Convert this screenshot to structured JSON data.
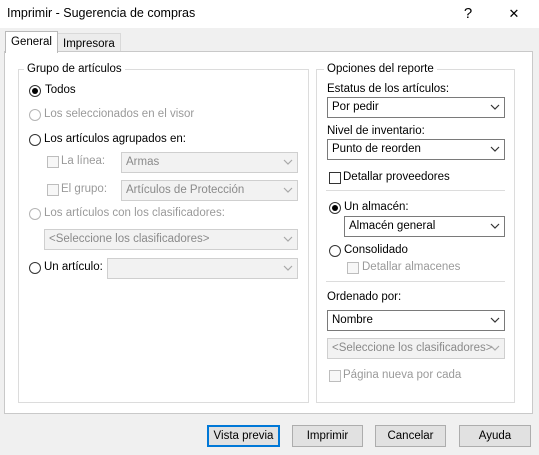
{
  "window": {
    "title": "Imprimir - Sugerencia de compras",
    "help_glyph": "?",
    "close_glyph": "✕"
  },
  "tabs": [
    {
      "label": "General"
    },
    {
      "label": "Impresora"
    }
  ],
  "grupo": {
    "legend": "Grupo de artículos",
    "todos": "Todos",
    "seleccionados": "Los seleccionados en el visor",
    "agrupados": "Los artículos agrupados en:",
    "linea_label": "La línea:",
    "linea_value": "Armas",
    "grupo_label": "El grupo:",
    "grupo_value": "Artículos de Protección",
    "clasificadores": "Los artículos con los clasificadores:",
    "clasificadores_value": "<Seleccione los clasificadores>",
    "un_articulo": "Un artículo:",
    "un_articulo_value": ""
  },
  "opciones": {
    "legend": "Opciones del reporte",
    "estatus_label": "Estatus de los artículos:",
    "estatus_value": "Por pedir",
    "nivel_label": "Nivel de inventario:",
    "nivel_value": "Punto de reorden",
    "detallar_proveedores": "Detallar proveedores",
    "un_almacen": "Un almacén:",
    "almacen_value": "Almacén general",
    "consolidado": "Consolidado",
    "detallar_almacenes": "Detallar almacenes",
    "ordenado_label": "Ordenado por:",
    "ordenado_value": "Nombre",
    "ordenado_clasif_value": "<Seleccione los clasificadores>",
    "pagina_nueva": "Página nueva por cada"
  },
  "buttons": {
    "vista_previa": "Vista previa",
    "imprimir": "Imprimir",
    "cancelar": "Cancelar",
    "ayuda": "Ayuda"
  },
  "colors": {
    "default_button_border": "#0078d7",
    "disabled_text": "#9a9a9a"
  }
}
